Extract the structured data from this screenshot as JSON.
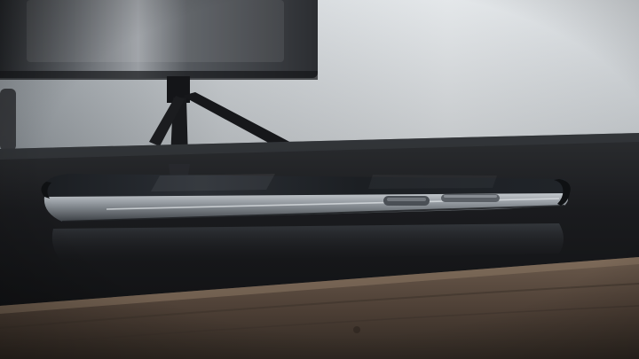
{
  "scene": {
    "subject": "smartphone-lying-on-side",
    "setting": "dark-wooden-desk",
    "background_object": "monitor-on-tripod-stand"
  },
  "colors": {
    "wall": "#d9dde0",
    "wall_shadow": "#aab0b6",
    "desk_top": "#1a1b1d",
    "desk_edge": "#5b4a3d",
    "monitor": "#2a2c30",
    "phone_body": "#16181b",
    "phone_frame": "#8d9399",
    "phone_button": "#4a4f55"
  }
}
